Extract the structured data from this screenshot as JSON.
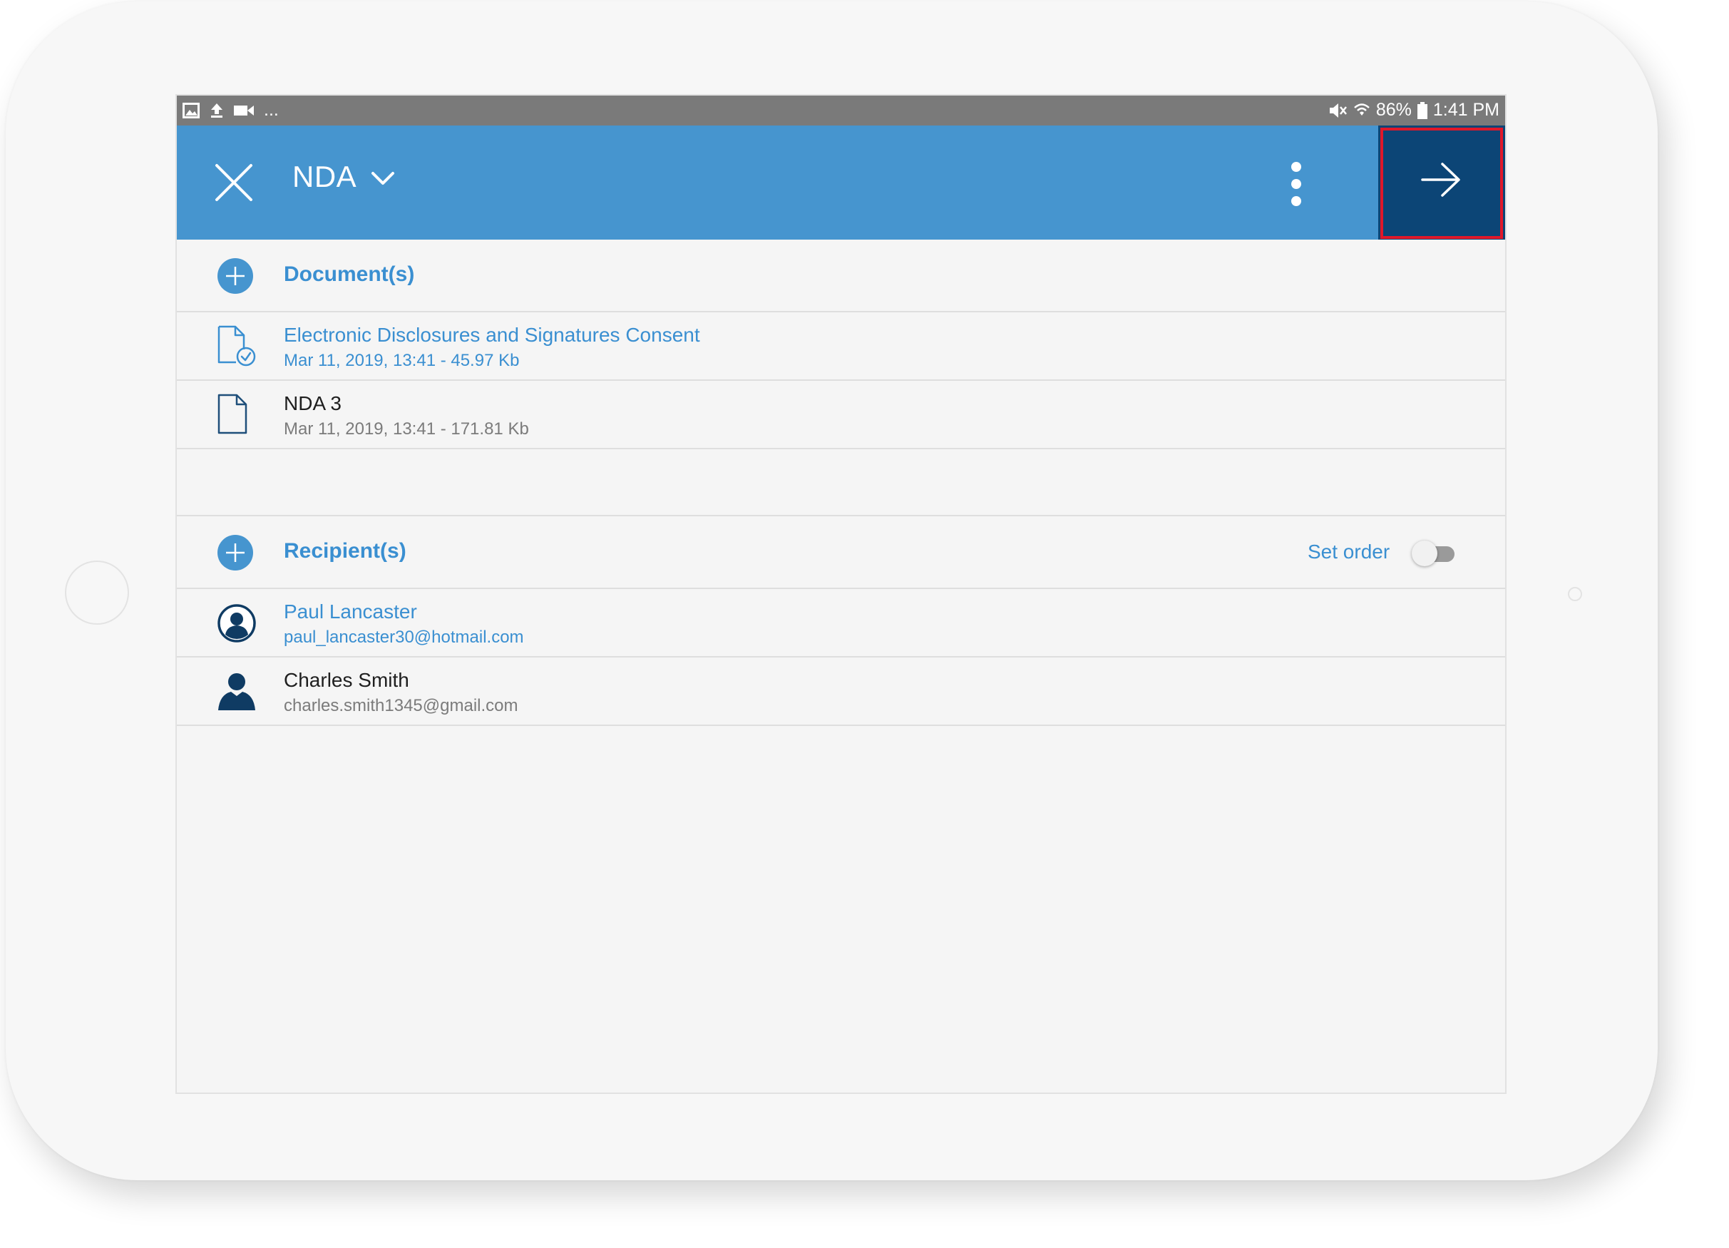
{
  "status_bar": {
    "left_icons": [
      "image-icon",
      "upload-icon",
      "video-icon"
    ],
    "more_indicator": "...",
    "right_icons": [
      "mute-icon",
      "wifi-icon",
      "battery-icon"
    ],
    "battery": "86%",
    "time": "1:41 PM"
  },
  "app_bar": {
    "title": "NDA",
    "close_icon": "close-icon",
    "dropdown_icon": "chevron-down-icon",
    "more_icon": "more-vertical-icon",
    "next_icon": "arrow-right-icon"
  },
  "documents": {
    "header": "Document(s)",
    "items": [
      {
        "name": "Electronic Disclosures and Signatures Consent",
        "meta": "Mar 11, 2019, 13:41 - 45.97 Kb",
        "icon": "document-check-icon"
      },
      {
        "name": "NDA 3",
        "meta": "Mar 11, 2019, 13:41 - 171.81 Kb",
        "icon": "document-icon"
      }
    ]
  },
  "recipients": {
    "header": "Recipient(s)",
    "set_order_label": "Set order",
    "set_order_enabled": false,
    "items": [
      {
        "name": "Paul Lancaster",
        "email": "paul_lancaster30@hotmail.com",
        "icon": "user-circle-icon"
      },
      {
        "name": "Charles Smith",
        "email": "charles.smith1345@gmail.com",
        "icon": "user-icon"
      }
    ]
  },
  "colors": {
    "app_bar": "#4695cf",
    "next_button": "#0c4576",
    "highlight": "#e0182a",
    "accent_text": "#3a8fd1",
    "status_bar": "#7a7a7a"
  }
}
